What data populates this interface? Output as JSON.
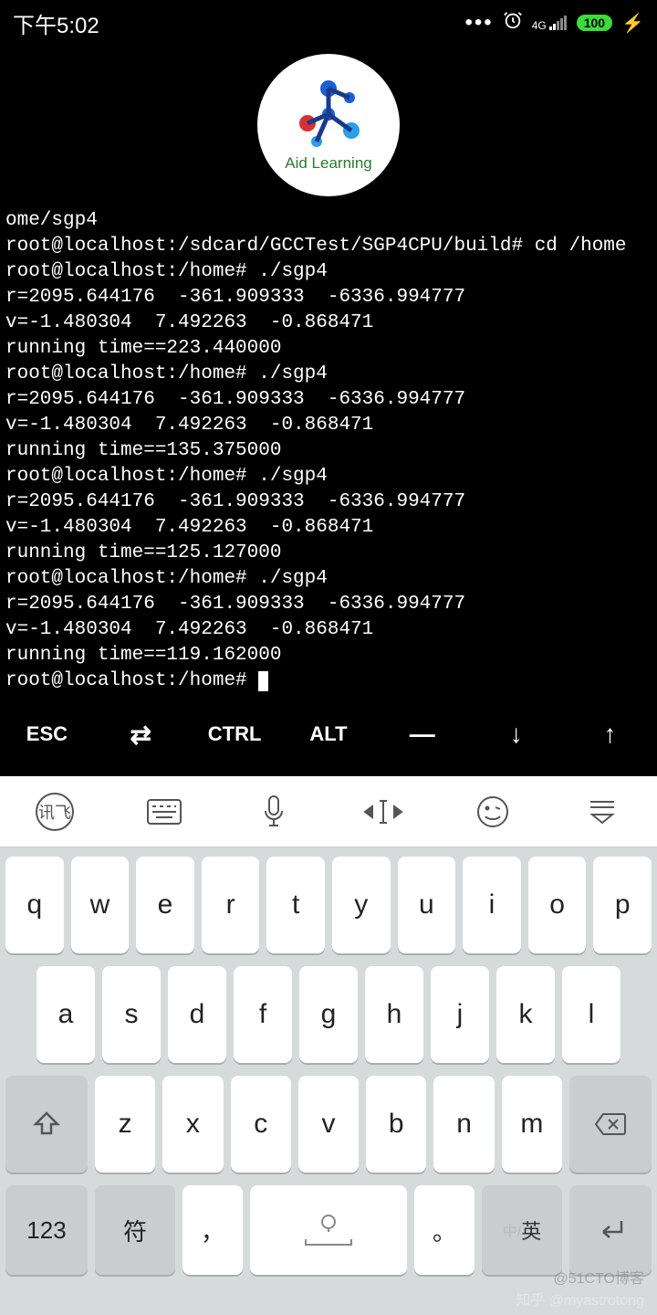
{
  "status": {
    "time": "下午5:02",
    "dots": "•••",
    "net": "4G",
    "battery": "100"
  },
  "logo": {
    "text": "Aid Learning"
  },
  "terminal": {
    "lines": [
      "ome/sgp4",
      "root@localhost:/sdcard/GCCTest/SGP4CPU/build# cd /home",
      "root@localhost:/home# ./sgp4",
      "r=2095.644176  -361.909333  -6336.994777",
      "v=-1.480304  7.492263  -0.868471",
      "running time==223.440000",
      "root@localhost:/home# ./sgp4",
      "r=2095.644176  -361.909333  -6336.994777",
      "v=-1.480304  7.492263  -0.868471",
      "running time==135.375000",
      "root@localhost:/home# ./sgp4",
      "r=2095.644176  -361.909333  -6336.994777",
      "v=-1.480304  7.492263  -0.868471",
      "running time==125.127000",
      "root@localhost:/home# ./sgp4",
      "r=2095.644176  -361.909333  -6336.994777",
      "v=-1.480304  7.492263  -0.868471",
      "running time==119.162000"
    ],
    "prompt": "root@localhost:/home# "
  },
  "extraKeys": {
    "esc": "ESC",
    "tab": "⇄",
    "ctrl": "CTRL",
    "alt": "ALT",
    "dash": "—",
    "down": "↓",
    "up": "↑"
  },
  "keyboard": {
    "row1": [
      "q",
      "w",
      "e",
      "r",
      "t",
      "y",
      "u",
      "i",
      "o",
      "p"
    ],
    "row2": [
      "a",
      "s",
      "d",
      "f",
      "g",
      "h",
      "j",
      "k",
      "l"
    ],
    "row3": [
      "z",
      "x",
      "c",
      "v",
      "b",
      "n",
      "m"
    ],
    "shift": "⇧",
    "backspace": "⌫",
    "k123": "123",
    "ksym": "符",
    "kcomma": "，",
    "kperiod": "。",
    "lang_cn": "中/",
    "lang_en": "英",
    "enter": "↵"
  },
  "watermark": "知乎 @myastrotong",
  "watermark2": "@51CTO博客"
}
